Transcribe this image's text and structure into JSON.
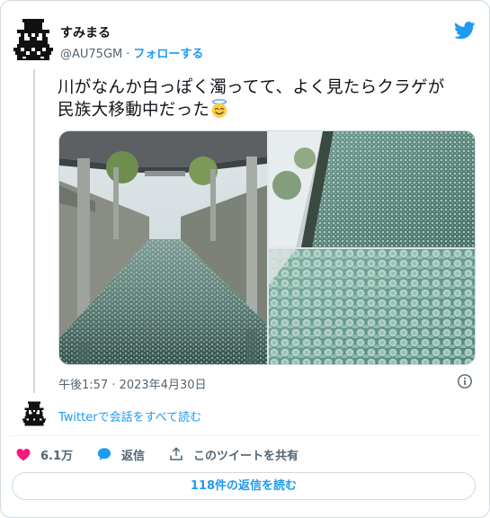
{
  "author": {
    "display_name": "すみまる",
    "handle": "@AU75GM",
    "separator": "·",
    "follow_label": "フォローする"
  },
  "tweet": {
    "text_line1": "川がなんか白っぽく濁ってて、よく見たらクラゲが",
    "text_line2": "民族大移動中だった",
    "emoji": "smiling-face-with-halo-icon",
    "timestamp": "午後1:57 · 2023年4月30日"
  },
  "media": [
    {
      "name": "river-under-bridge-photo"
    },
    {
      "name": "river-surface-photo"
    },
    {
      "name": "jellyfish-closeup-photo"
    }
  ],
  "thread": {
    "read_more_label": "Twitterで会話をすべて読む"
  },
  "actions": {
    "like_count": "6.1万",
    "reply_label": "返信",
    "share_label": "このツイートを共有"
  },
  "read_replies_label": "118件の返信を読む",
  "colors": {
    "accent": "#1d9bf0",
    "like": "#f91880",
    "secondary_text": "#536471",
    "border": "#cfd9de"
  }
}
